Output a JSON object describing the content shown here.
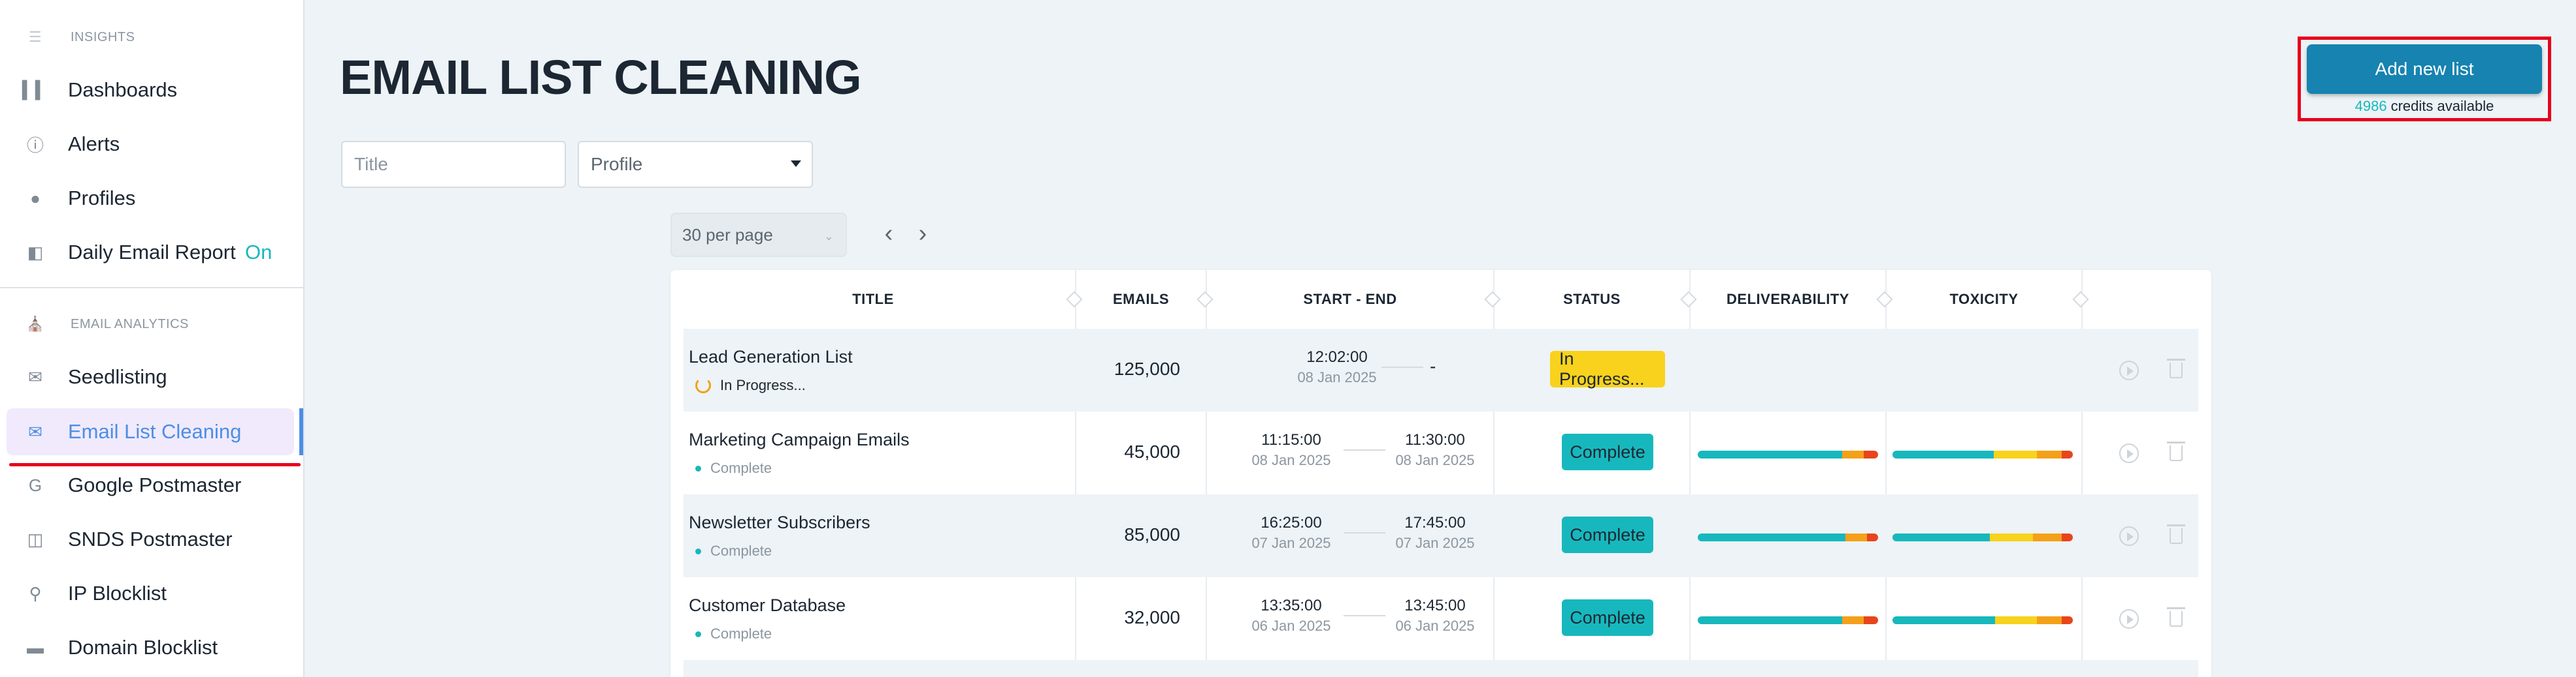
{
  "sidebar": {
    "section_insights": "INSIGHTS",
    "section_email_analytics": "EMAIL ANALYTICS",
    "items": [
      {
        "label": "Dashboards",
        "icon": "bar-chart-icon"
      },
      {
        "label": "Alerts",
        "icon": "info-icon"
      },
      {
        "label": "Profiles",
        "icon": "user-icon"
      },
      {
        "label": "Daily Email Report",
        "icon": "report-icon",
        "extra": "On"
      },
      {
        "label": "Seedlisting",
        "icon": "envelope-icon"
      },
      {
        "label": "Email List Cleaning",
        "icon": "envelope-icon",
        "active": true
      },
      {
        "label": "Google Postmaster",
        "icon": "google-icon"
      },
      {
        "label": "SNDS Postmaster",
        "icon": "outlook-icon"
      },
      {
        "label": "IP Blocklist",
        "icon": "location-pin-icon"
      },
      {
        "label": "Domain Blocklist",
        "icon": "domain-icon"
      }
    ]
  },
  "main": {
    "title": "EMAIL LIST CLEANING",
    "filters": {
      "title_placeholder": "Title",
      "profile_selected": "Profile"
    },
    "add_button": "Add new list",
    "credits_count": "4986",
    "credits_text": "credits available",
    "per_page": "30 per page"
  },
  "table": {
    "headers": [
      "TITLE",
      "EMAILS",
      "START - END",
      "STATUS",
      "DELIVERABILITY",
      "TOXICITY"
    ],
    "rows": [
      {
        "title": "Lead Generation List",
        "sub": "In Progress...",
        "emails": "125,000",
        "start_time": "12:02:00",
        "start_date": "08 Jan 2025",
        "end_time": "-",
        "end_date": "",
        "status": "In Progress...",
        "state": "progress"
      },
      {
        "title": "Marketing Campaign Emails",
        "sub": "Complete",
        "emails": "45,000",
        "start_time": "11:15:00",
        "start_date": "08 Jan 2025",
        "end_time": "11:30:00",
        "end_date": "08 Jan 2025",
        "status": "Complete",
        "state": "complete"
      },
      {
        "title": "Newsletter Subscribers",
        "sub": "Complete",
        "emails": "85,000",
        "start_time": "16:25:00",
        "start_date": "07 Jan 2025",
        "end_time": "17:45:00",
        "end_date": "07 Jan 2025",
        "status": "Complete",
        "state": "complete"
      },
      {
        "title": "Customer Database",
        "sub": "Complete",
        "emails": "32,000",
        "start_time": "13:35:00",
        "start_date": "06 Jan 2025",
        "end_time": "13:45:00",
        "end_date": "06 Jan 2025",
        "status": "Complete",
        "state": "complete"
      }
    ]
  },
  "colors": {
    "accent_teal": "#17b8bd",
    "button_blue": "#1683b0",
    "progress_yellow": "#f8d21c",
    "active_blue": "#4c8ee6",
    "highlight_red": "#e8001c"
  }
}
